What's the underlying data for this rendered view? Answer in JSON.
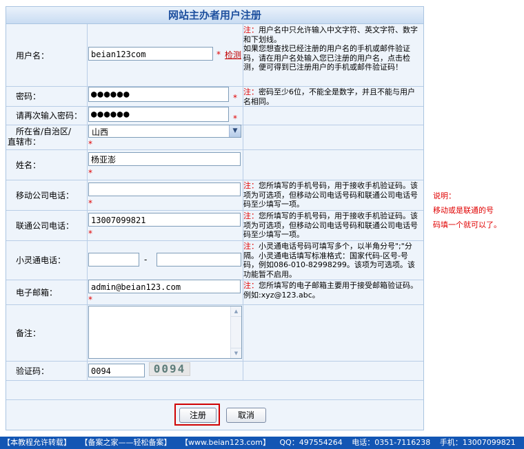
{
  "title": "网站主办者用户注册",
  "form": {
    "username": {
      "label": "用户名：",
      "value": "beian123com",
      "check_link": "检测",
      "note_prefix": "注：",
      "note": "用户名中只允许输入中文字符、英文字符、数字和下划线。",
      "note2": "如果您想查找已经注册的用户名的手机或邮件验证码，请在用户名处输入您已注册的用户名，点击检测，便可得到已注册用户的手机或邮件验证码！"
    },
    "password": {
      "label": "密码：",
      "value": "●●●●●●",
      "note_prefix": "注：",
      "note": "密码至少6位，不能全是数字，并且不能与用户名相同。"
    },
    "password_confirm": {
      "label": "请再次输入密码：",
      "value": "●●●●●●"
    },
    "province": {
      "label": "所在省/自治区/直辖市：",
      "value": "山西"
    },
    "name": {
      "label": "姓名：",
      "value": "杨亚澎"
    },
    "mobile": {
      "label": "移动公司电话：",
      "value": "",
      "note_prefix": "注：",
      "note": "您所填写的手机号码，用于接收手机验证码。该项为可选项，但移动公司电话号码和联通公司电话号码至少填写一项。"
    },
    "unicom": {
      "label": "联通公司电话：",
      "value": "13007099821",
      "note_prefix": "注：",
      "note": "您所填写的手机号码，用于接收手机验证码。该项为可选项，但移动公司电话号码和联通公司电话号码至少填写一项。"
    },
    "phs": {
      "label": "小灵通电话：",
      "value1": "",
      "separator": "-",
      "value2": "",
      "note_prefix": "注：",
      "note": "小灵通电话号码可填写多个，以半角分号\";\"分隔。小灵通电话填写标准格式：国家代码-区号-号码，例如086-010-82998299。该项为可选项。该功能暂不启用。"
    },
    "email": {
      "label": "电子邮箱：",
      "value": "admin@beian123.com",
      "note_prefix": "注：",
      "note": "您所填写的电子邮箱主要用于接受邮箱验证码。例如:xyz@123.abc。"
    },
    "remark": {
      "label": "备注：",
      "value": ""
    },
    "captcha": {
      "label": "验证码：",
      "value": "0094",
      "image_text": "0094"
    },
    "required_mark": "*"
  },
  "buttons": {
    "submit": "注册",
    "cancel": "取消"
  },
  "side_note": {
    "title": "说明：",
    "line1": "移动或是联通的号",
    "line2": "码填一个就可以了。"
  },
  "footer": {
    "items": [
      "【本教程允许转载】",
      "【备案之家——轻松备案】",
      "【www.beian123.com】",
      "QQ：497554264",
      "电话：0351-7116238",
      "手机：13007099821"
    ]
  },
  "colors": {
    "accent": "#1d4f9e",
    "required": "#e00000",
    "footer_bg": "#1356b4",
    "highlight_border": "#d00000"
  }
}
